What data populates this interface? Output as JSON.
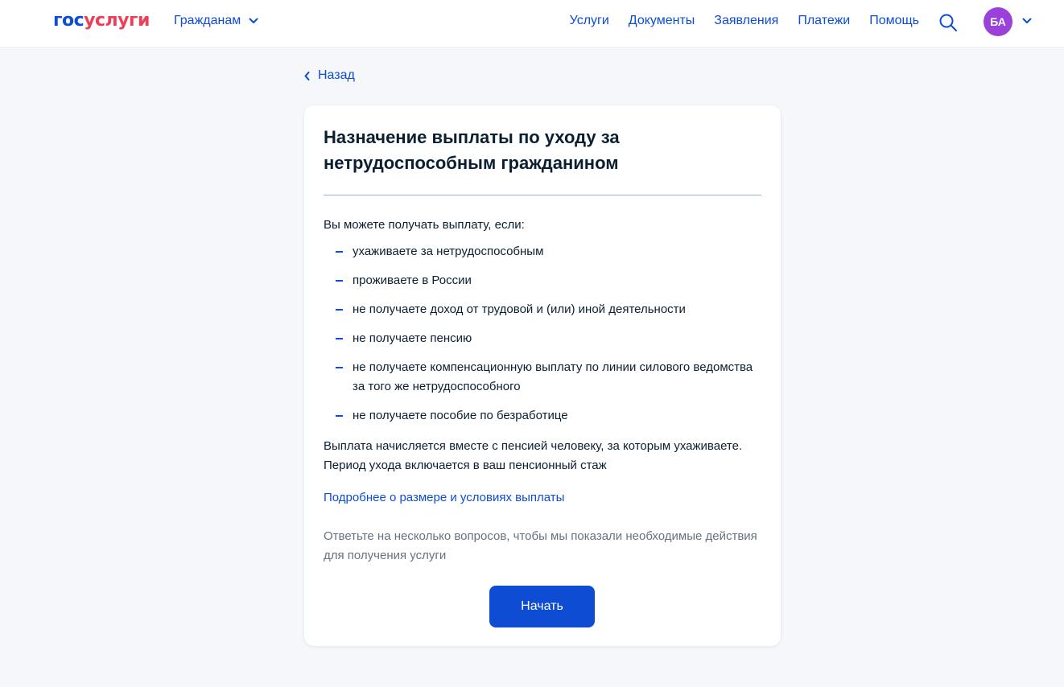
{
  "header": {
    "logo_part1": "гос",
    "logo_part2": "услуги",
    "audience_selector": "Гражданам",
    "nav": [
      "Услуги",
      "Документы",
      "Заявления",
      "Платежи",
      "Помощь"
    ],
    "avatar_initials": "БА"
  },
  "back_label": "Назад",
  "card": {
    "title": "Назначение выплаты по уходу за нетрудоспособным гражданином",
    "intro": "Вы можете получать выплату, если:",
    "conditions": [
      "ухаживаете за нетрудоспособным",
      "проживаете в России",
      "не получаете доход от трудовой и (или) иной деятельности",
      "не получаете пенсию",
      "не получаете компенсационную выплату по линии силового ведомства за того же нетрудоспособного",
      "не получаете пособие по безработице"
    ],
    "payment_note": "Выплата начисляется вместе с пенсией человеку, за которым ухаживаете. Период ухода включается в ваш пенсионный стаж",
    "more_link": "Подробнее о размере и условиях выплаты",
    "questions_note": "Ответьте на несколько вопросов, чтобы мы показали необходимые действия для получения услуги",
    "start_button": "Начать"
  },
  "colors": {
    "brand_blue": "#0d4cd3",
    "brand_red": "#ee3f58",
    "avatar": "#9a41db",
    "background": "#f5f7fb"
  }
}
